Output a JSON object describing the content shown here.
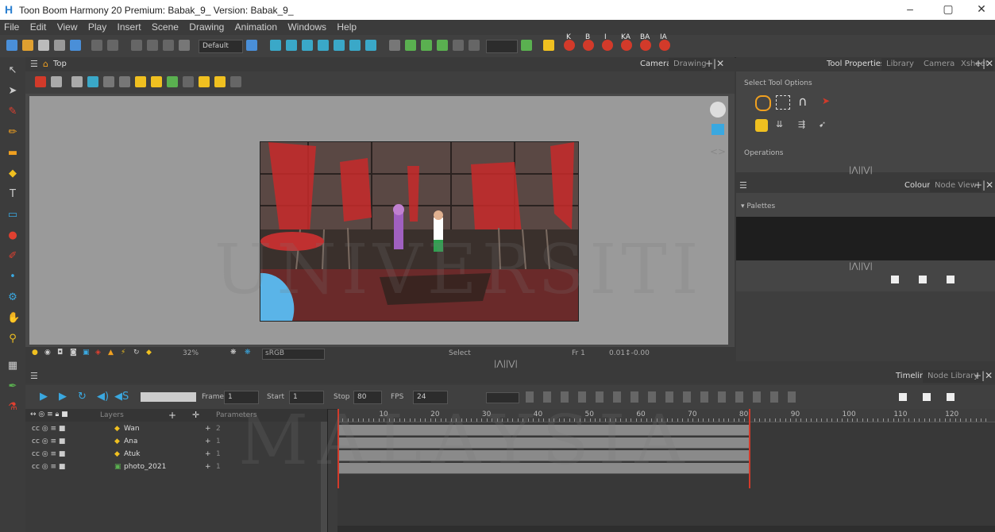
{
  "window": {
    "title": "Toon Boom Harmony 20 Premium: Babak_9_ Version: Babak_9_",
    "logo_glyph": "H",
    "minimize": "–",
    "maximize": "▢",
    "close": "✕"
  },
  "menu": [
    "File",
    "Edit",
    "View",
    "Play",
    "Insert",
    "Scene",
    "Drawing",
    "Animation",
    "Windows",
    "Help"
  ],
  "toolbar": {
    "workspace_dropdown": "Default",
    "letter_icons": [
      "K",
      "B",
      "I",
      "KA",
      "BA",
      "IA"
    ]
  },
  "camera_view": {
    "breadcrumb": "Top",
    "tabs": [
      "Camera",
      "Drawing"
    ],
    "zoom": "32%",
    "colorspace": "sRGB",
    "status_mode": "Select",
    "frame_readout": "Fr 1",
    "coords_readout": "0.01↕-0.00"
  },
  "tool_properties": {
    "tabs": [
      "Tool Properties",
      "Library",
      "Camera",
      "Xsheet"
    ],
    "select_tool_options": "Select Tool Options",
    "operations": "Operations"
  },
  "colour_panel": {
    "tabs": [
      "Colour",
      "Node View"
    ],
    "palettes_label": "Palettes"
  },
  "timeline": {
    "tabs": [
      "Timeline",
      "Node Library"
    ],
    "frame_label": "Frame",
    "frame_value": "1",
    "start_label": "Start",
    "start_value": "1",
    "stop_label": "Stop",
    "stop_value": "80",
    "fps_label": "FPS",
    "fps_value": "24",
    "layers_header": "Layers",
    "parameters_header": "Parameters",
    "layers": [
      {
        "name": "Wan",
        "param": "2"
      },
      {
        "name": "Ana",
        "param": "1"
      },
      {
        "name": "Atuk",
        "param": "1"
      },
      {
        "name": "photo_2021",
        "param": "1"
      }
    ],
    "ruler_labels": [
      "10",
      "20",
      "30",
      "40",
      "50",
      "60",
      "70",
      "80",
      "90",
      "100",
      "110",
      "120"
    ]
  },
  "watermark": {
    "line1": "UNIVERSITI",
    "line2": "MALAYSIA"
  },
  "colors": {
    "accent_red": "#d23a2a",
    "timeline_bar": "#8a8a8a",
    "panel": "#454545",
    "background": "#3a3a3a"
  }
}
